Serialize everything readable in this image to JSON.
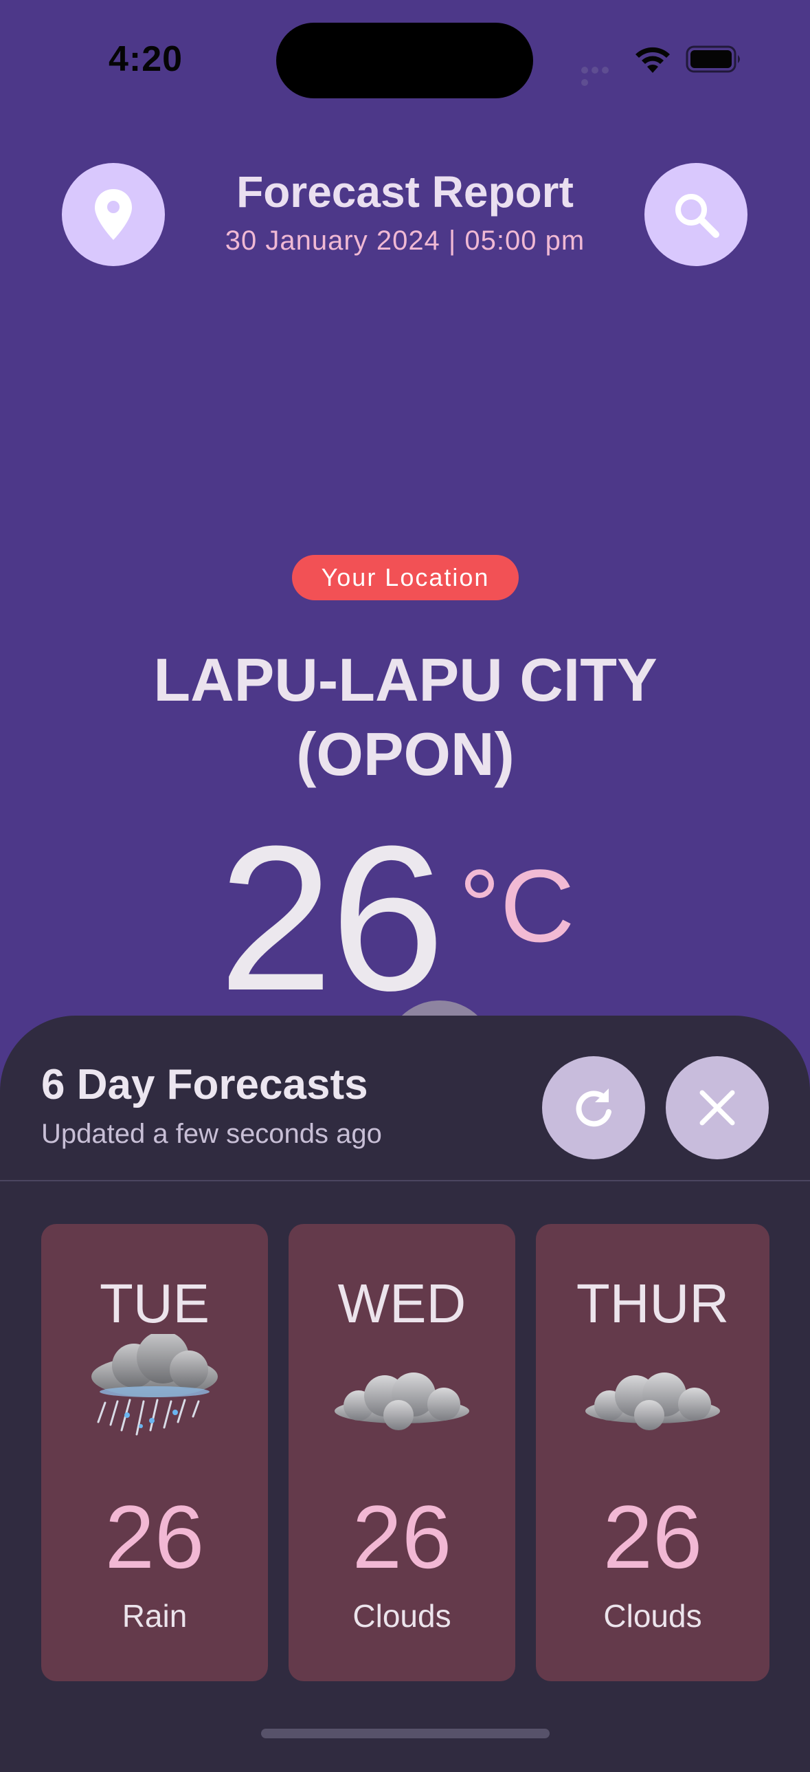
{
  "status_bar": {
    "time": "4:20"
  },
  "header": {
    "title": "Forecast Report",
    "datetime": "30 January 2024 | 05:00 pm",
    "left_icon": "location-pin-icon",
    "right_icon": "search-icon"
  },
  "location": {
    "badge": "Your Location",
    "city": "LAPU-LAPU CITY (OPON)",
    "temperature": "26",
    "unit": "°C"
  },
  "forecast_sheet": {
    "title": "6 Day Forecasts",
    "subtitle": "Updated a few seconds ago",
    "refresh_icon": "refresh-icon",
    "close_icon": "close-icon",
    "days": [
      {
        "day": "TUE",
        "icon": "rain-cloud-icon",
        "temp": "26",
        "condition": "Rain"
      },
      {
        "day": "WED",
        "icon": "cloud-icon",
        "temp": "26",
        "condition": "Clouds"
      },
      {
        "day": "THUR",
        "icon": "cloud-icon",
        "temp": "26",
        "condition": "Clouds"
      }
    ]
  },
  "colors": {
    "background": "#4d3889",
    "sheet": "#302b40",
    "card": "#643a4b",
    "accent_pink": "#f2b8d4",
    "badge_red": "#f25155",
    "button_lilac": "#d9c8fd"
  }
}
